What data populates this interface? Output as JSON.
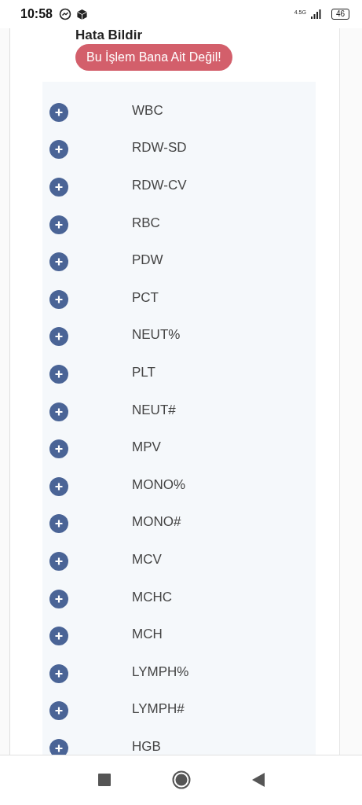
{
  "status_bar": {
    "time": "10:58",
    "network": "4.5G",
    "battery": "46"
  },
  "heading": "Hata Bildir",
  "report_button": "Bu İşlem Bana Ait Değil!",
  "tests": [
    "WBC",
    "RDW-SD",
    "RDW-CV",
    "RBC",
    "PDW",
    "PCT",
    "NEUT%",
    "PLT",
    "NEUT#",
    "MPV",
    "MONO%",
    "MONO#",
    "MCV",
    "MCHC",
    "MCH",
    "LYMPH%",
    "LYMPH#",
    "HGB"
  ]
}
